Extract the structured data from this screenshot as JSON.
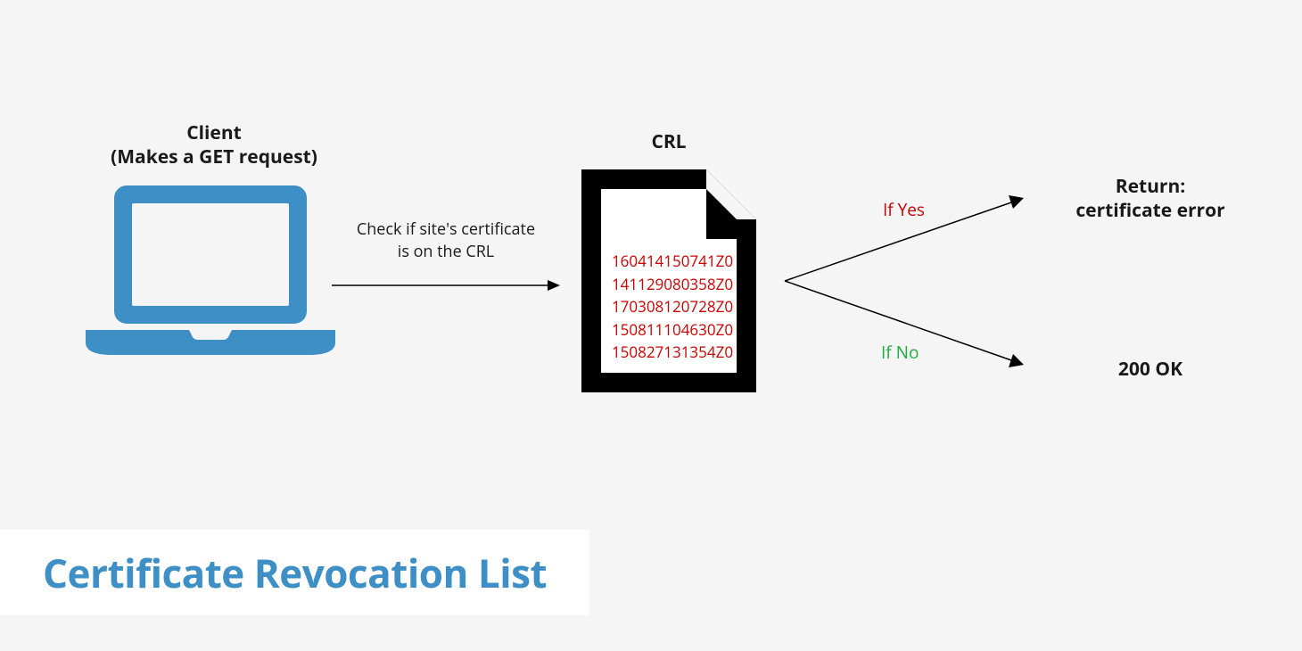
{
  "client": {
    "label_line1": "Client",
    "label_line2": "(Makes a GET request)"
  },
  "crl": {
    "label": "CRL",
    "entries": [
      "160414150741Z0",
      "141129080358Z0",
      "170308120728Z0",
      "150811104630Z0",
      "150827131354Z0"
    ]
  },
  "arrow1": {
    "line1": "Check if site's certificate",
    "line2": "is on the CRL"
  },
  "branches": {
    "yes_label": "If Yes",
    "no_label": "If No"
  },
  "results": {
    "error_line1": "Return:",
    "error_line2": "certificate error",
    "ok": "200 OK"
  },
  "title": "Certificate Revocation List",
  "colors": {
    "accent": "#3d8fc6",
    "red": "#cc0000",
    "green": "#1aaf3f",
    "black": "#000000"
  }
}
